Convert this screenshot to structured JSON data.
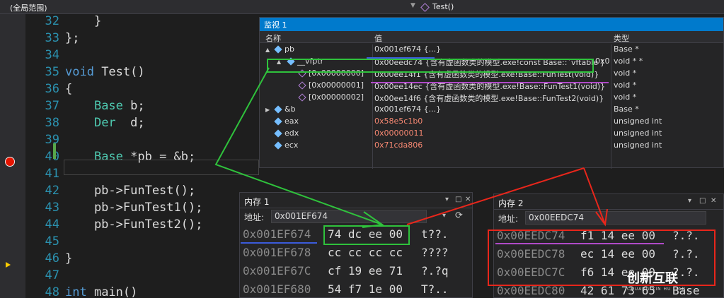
{
  "topbar": {
    "scope": "(全局范围)",
    "function": "Test()"
  },
  "code": [
    {
      "ln": "32",
      "text": "    }"
    },
    {
      "ln": "33",
      "text": "};"
    },
    {
      "ln": "34",
      "text": ""
    },
    {
      "ln": "35",
      "text": "void Test()"
    },
    {
      "ln": "36",
      "text": "{"
    },
    {
      "ln": "37",
      "text": "    Base b;"
    },
    {
      "ln": "38",
      "text": "    Der  d;"
    },
    {
      "ln": "39",
      "text": ""
    },
    {
      "ln": "40",
      "text": "    Base *pb = &b;"
    },
    {
      "ln": "41",
      "text": ""
    },
    {
      "ln": "42",
      "text": "    pb->FunTest();"
    },
    {
      "ln": "43",
      "text": "    pb->FunTest1();"
    },
    {
      "ln": "44",
      "text": "    pb->FunTest2();"
    },
    {
      "ln": "45",
      "text": ""
    },
    {
      "ln": "46",
      "text": "}"
    },
    {
      "ln": "47",
      "text": ""
    },
    {
      "ln": "48",
      "text": "int main()"
    }
  ],
  "watch": {
    "title": "监视 1",
    "col_name": "名称",
    "col_value": "值",
    "col_type": "类型",
    "rows": [
      {
        "name": "pb",
        "value": "0x001ef674 {...}",
        "type": "Base *"
      },
      {
        "name": "__vfptr",
        "value": "0x00eedc74 {含有虚函数类的模型.exe!const Base::`vftable'}",
        "tail": "0x0",
        "type": "void * *"
      },
      {
        "name": "[0x00000000]",
        "value": "0x00ee14f1 {含有虚函数类的模型.exe!Base::FunTest(void)}",
        "type": "void *"
      },
      {
        "name": "[0x00000001]",
        "value": "0x00ee14ec {含有虚函数类的模型.exe!Base::FunTest1(void)}",
        "type": "void *"
      },
      {
        "name": "[0x00000002]",
        "value": "0x00ee14f6 {含有虚函数类的模型.exe!Base::FunTest2(void)}",
        "type": "void *"
      },
      {
        "name": "&b",
        "value": "0x001ef674 {...}",
        "type": "Base *"
      },
      {
        "name": "eax",
        "value": "0x58e5c1b0",
        "type": "unsigned int"
      },
      {
        "name": "edx",
        "value": "0x00000011",
        "type": "unsigned int"
      },
      {
        "name": "ecx",
        "value": "0x71cda806",
        "type": "unsigned int"
      }
    ]
  },
  "mem1": {
    "title": "内存 1",
    "addr_label": "地址:",
    "addr": "0x001EF674",
    "lines": [
      {
        "a": "0x001EF674",
        "b": "74 dc ee 00",
        "c": "t??."
      },
      {
        "a": "0x001EF678",
        "b": "cc cc cc cc",
        "c": "????"
      },
      {
        "a": "0x001EF67C",
        "b": "cf 19 ee 71",
        "c": "?.?q"
      },
      {
        "a": "0x001EF680",
        "b": "54 f7 1e 00",
        "c": "T?.."
      }
    ]
  },
  "mem2": {
    "title": "内存 2",
    "addr_label": "地址:",
    "addr": "0x00EEDC74",
    "lines": [
      {
        "a": "0x00EEDC74",
        "b": "f1 14 ee 00",
        "c": "?.?."
      },
      {
        "a": "0x00EEDC78",
        "b": "ec 14 ee 00",
        "c": "?.?."
      },
      {
        "a": "0x00EEDC7C",
        "b": "f6 14 ee 00",
        "c": "?.?."
      },
      {
        "a": "0x00EEDC80",
        "b": "42 61 73 65",
        "c": "Base"
      }
    ]
  },
  "watermark": {
    "name": "创新互联",
    "sub": "CHUANG XIN HU LIAN"
  }
}
